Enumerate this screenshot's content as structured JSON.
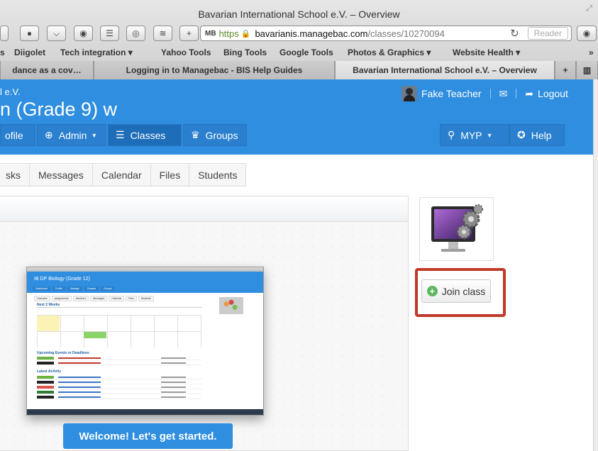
{
  "window": {
    "title": "Bavarian International School e.V. – Overview"
  },
  "toolbar": {
    "url_mb": "MB",
    "url_scheme": "https",
    "url_domain": "bavarianis.managebac.com",
    "url_path": "/classes/10270094",
    "reload_glyph": "↻",
    "reader_label": "Reader",
    "add_glyph": "+"
  },
  "bookmarks": [
    {
      "label": "s"
    },
    {
      "label": "Diigolet"
    },
    {
      "label": "Tech integration ▾"
    },
    {
      "label": "Yahoo Tools"
    },
    {
      "label": "Bing Tools"
    },
    {
      "label": "Google Tools"
    },
    {
      "label": "Photos & Graphics ▾"
    },
    {
      "label": "Website Health ▾"
    },
    {
      "label": "»"
    }
  ],
  "tabs": [
    {
      "label": "dance as a cov…"
    },
    {
      "label": "Logging in to Managebac - BIS Help Guides"
    },
    {
      "label": "Bavarian International School e.V. – Overview"
    },
    {
      "label": "+"
    }
  ],
  "header": {
    "school_name": "l e.V.",
    "class_title": "n (Grade 9) w",
    "user_name": "Fake Teacher",
    "mail_icon": "✉",
    "logout_label": "Logout",
    "nav": [
      {
        "label": "ofile",
        "icon": ""
      },
      {
        "label": "Admin",
        "icon": "globe-icon"
      },
      {
        "label": "Classes",
        "icon": "list-icon"
      },
      {
        "label": "Groups",
        "icon": "trophy-icon"
      }
    ],
    "myp_label": "MYP",
    "help_label": "Help"
  },
  "subnav": [
    "sks",
    "Messages",
    "Calendar",
    "Files",
    "Students"
  ],
  "mockup": {
    "title": "IB DP Biology (Grade 12)",
    "nav": [
      "Dashboard",
      "Profile",
      "Manage",
      "Classes",
      "Groups"
    ],
    "tabs": [
      "Overview",
      "Assignments",
      "Members",
      "Messages",
      "Calendar",
      "Files",
      "Students"
    ],
    "next_weeks": "Next 2 Weeks",
    "upcoming": "Upcoming Events or Deadlines",
    "latest": "Latest Activity"
  },
  "welcome_label": "Welcome! Let's get started.",
  "join_label": "Join class",
  "colors": {
    "brand_blue": "#2f8ee0",
    "highlight_red": "#c0392b",
    "join_green": "#5cb85c"
  }
}
